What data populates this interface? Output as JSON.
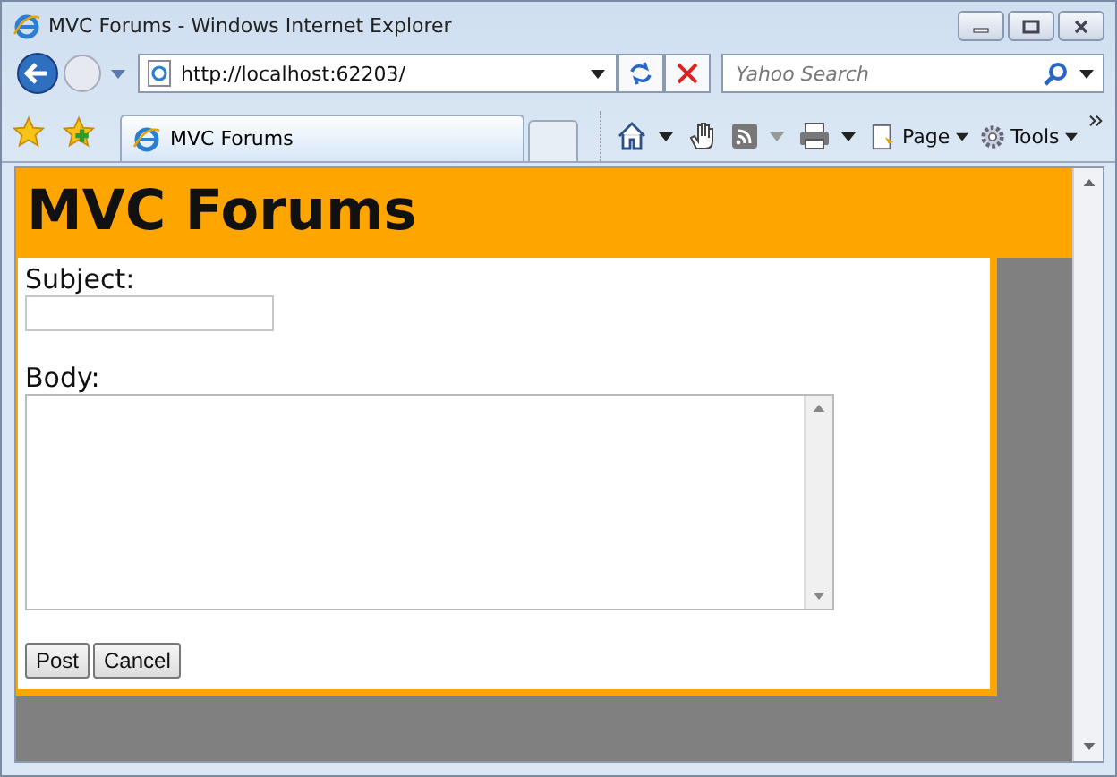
{
  "window": {
    "title": "MVC Forums - Windows Internet Explorer"
  },
  "address": {
    "url": "http://localhost:62203/"
  },
  "search": {
    "placeholder": "Yahoo Search"
  },
  "tabs": [
    {
      "label": "MVC Forums",
      "selected": true
    }
  ],
  "toolbar": [
    {
      "kind": "home"
    },
    {
      "kind": "hand"
    },
    {
      "kind": "feed"
    },
    {
      "kind": "print"
    },
    {
      "kind": "page",
      "label": "Page"
    },
    {
      "kind": "tools",
      "label": "Tools"
    }
  ],
  "page": {
    "heading": "MVC Forums",
    "fields": [
      {
        "kind": "input",
        "label": "Subject:"
      },
      {
        "kind": "textarea",
        "label": "Body:"
      }
    ],
    "buttons": [
      "Post",
      "Cancel"
    ]
  }
}
